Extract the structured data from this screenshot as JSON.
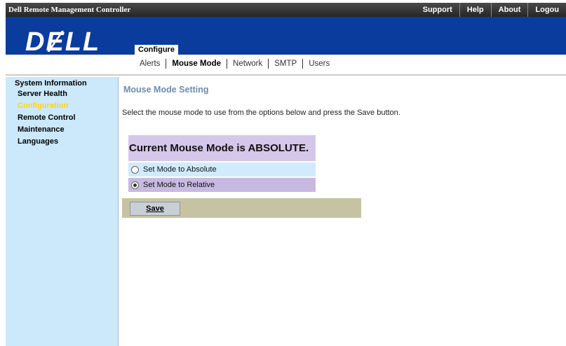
{
  "topbar": {
    "app_title": "Dell Remote Management Controller",
    "links": [
      "Support",
      "Help",
      "About",
      "Logou"
    ]
  },
  "header": {
    "logo_text": "DɆLL",
    "configure_tab": "Configure"
  },
  "subnav": {
    "tabs": [
      "Alerts",
      "Mouse Mode",
      "Network",
      "SMTP",
      "Users"
    ],
    "active": "Mouse Mode"
  },
  "sidebar": {
    "head": "System Information",
    "items": [
      "Server Health",
      "Configuration",
      "Remote Control",
      "Maintenance",
      "Languages"
    ],
    "active": "Configuration"
  },
  "main": {
    "section_title": "Mouse Mode Setting",
    "instructions": "Select the mouse mode to use from the options below and press the Save button.",
    "current_mode_text": "Current Mouse Mode is ABSOLUTE.",
    "options": [
      {
        "label": "Set Mode to Absolute",
        "checked": false
      },
      {
        "label": "Set Mode to Relative",
        "checked": true
      }
    ],
    "save_label": "Save"
  },
  "colors": {
    "brand_blue": "#0a3c9e",
    "sidebar_bg": "#cce8fb",
    "active_nav": "#ffd31a",
    "section_title": "#6e8bb2",
    "status_bg": "#d4c7e9",
    "save_bar": "#c6c3a3"
  }
}
